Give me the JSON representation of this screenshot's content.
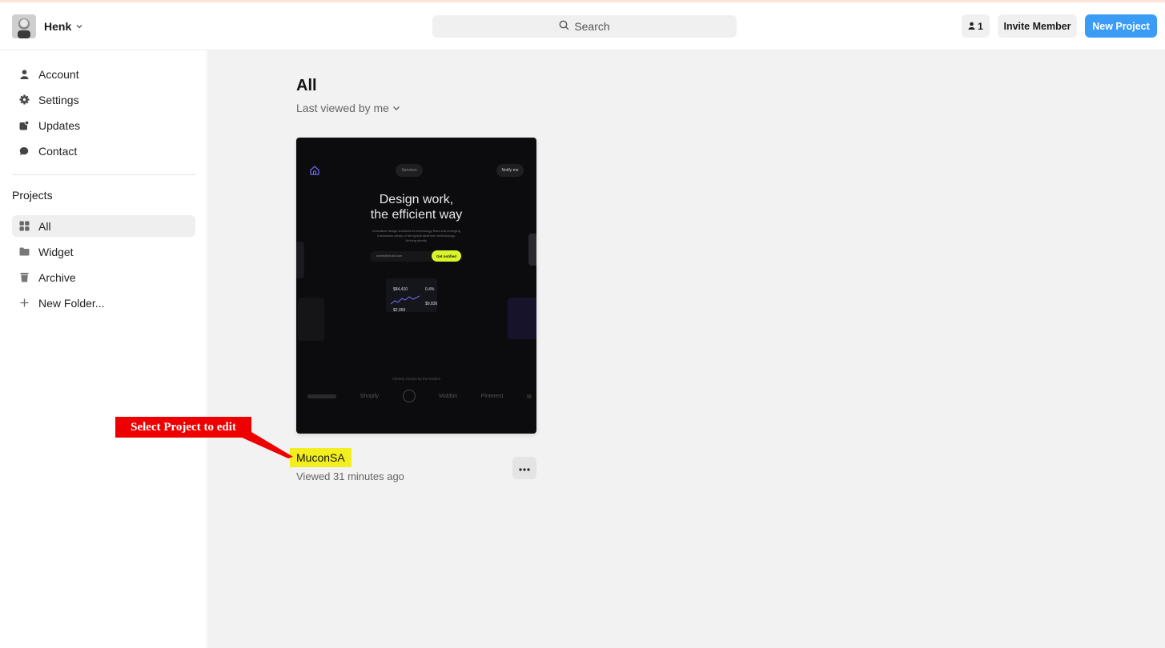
{
  "header": {
    "user_name": "Henk",
    "search_placeholder": "Search",
    "member_count": "1",
    "invite_label": "Invite Member",
    "new_project_label": "New Project"
  },
  "sidebar": {
    "items": [
      {
        "label": "Account",
        "icon": "person-icon"
      },
      {
        "label": "Settings",
        "icon": "gear-icon"
      },
      {
        "label": "Updates",
        "icon": "updates-icon"
      },
      {
        "label": "Contact",
        "icon": "chat-icon"
      }
    ],
    "projects_title": "Projects",
    "project_items": [
      {
        "label": "All",
        "icon": "grid-icon",
        "active": true
      },
      {
        "label": "Widget",
        "icon": "folder-icon"
      },
      {
        "label": "Archive",
        "icon": "trash-icon"
      },
      {
        "label": "New Folder...",
        "icon": "plus-icon"
      }
    ]
  },
  "main": {
    "title": "All",
    "sort_label": "Last viewed by me",
    "project": {
      "name": "MuconSA",
      "meta": "Viewed 31 minutes ago",
      "thumbnail": {
        "nav_pill": "Services",
        "nav_cta": "Notify me",
        "headline_1": "Design work,",
        "headline_2": "the efficient way",
        "subtext": "Innovative design solutions for technology firms and emerging businesses weary of the typical aesthetic methodology. Arriving shortly.",
        "email_placeholder": "name@email.com",
        "cta_label": "Get notified",
        "dash_value_1": "$84,410",
        "dash_value_2": "0.4%",
        "dash_value_3": "$9,836",
        "dash_value_4": "$2,950",
        "leaders_text": "Already chosen by the leaders",
        "logos": [
          "Shopify",
          "Mobbin",
          "Pinterest"
        ]
      }
    }
  },
  "annotation": {
    "callout_text": "Select Project to edit"
  },
  "colors": {
    "accent": "#3b9cf5",
    "highlight": "#f3ef1f",
    "callout": "#ee0000",
    "thumb_cta": "#d9f52a"
  }
}
